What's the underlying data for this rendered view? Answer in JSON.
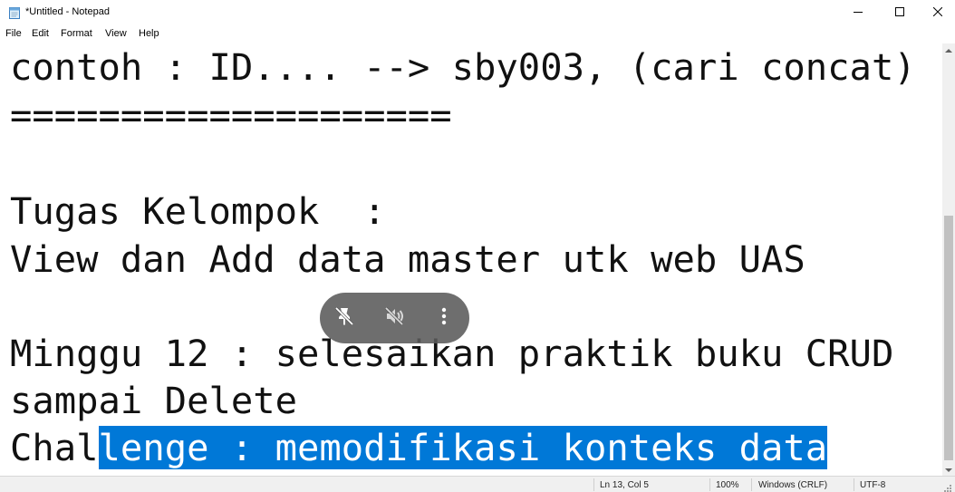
{
  "window": {
    "title": "*Untitled - Notepad",
    "controls": {
      "minimize_icon": "minimize-icon",
      "maximize_icon": "maximize-icon",
      "close_icon": "close-icon"
    }
  },
  "menu": {
    "items": [
      {
        "label": "File"
      },
      {
        "label": "Edit"
      },
      {
        "label": "Format"
      },
      {
        "label": "View"
      },
      {
        "label": "Help"
      }
    ]
  },
  "editor": {
    "lines": [
      {
        "text": "contoh : ID.... --> sby003, (cari concat)"
      },
      {
        "text": "===================="
      },
      {
        "text": ""
      },
      {
        "text": "Tugas Kelompok  :"
      },
      {
        "text": "View dan Add data master utk web UAS"
      },
      {
        "text": ""
      },
      {
        "text": "Minggu 12 : selesaikan praktik buku CRUD"
      },
      {
        "text": "sampai Delete"
      },
      {
        "text": "Challenge : memodifikasi konteks data",
        "unselected": "Chal",
        "selected": "lenge : memodifikasi konteks data"
      }
    ],
    "selection_color": "#0078d7"
  },
  "status": {
    "position": "Ln 13, Col 5",
    "zoom": "100%",
    "line_ending": "Windows (CRLF)",
    "encoding": "UTF-8"
  },
  "overlay": {
    "buttons": [
      {
        "icon": "pin-off-icon"
      },
      {
        "icon": "mute-icon"
      },
      {
        "icon": "more-vertical-icon"
      }
    ]
  }
}
